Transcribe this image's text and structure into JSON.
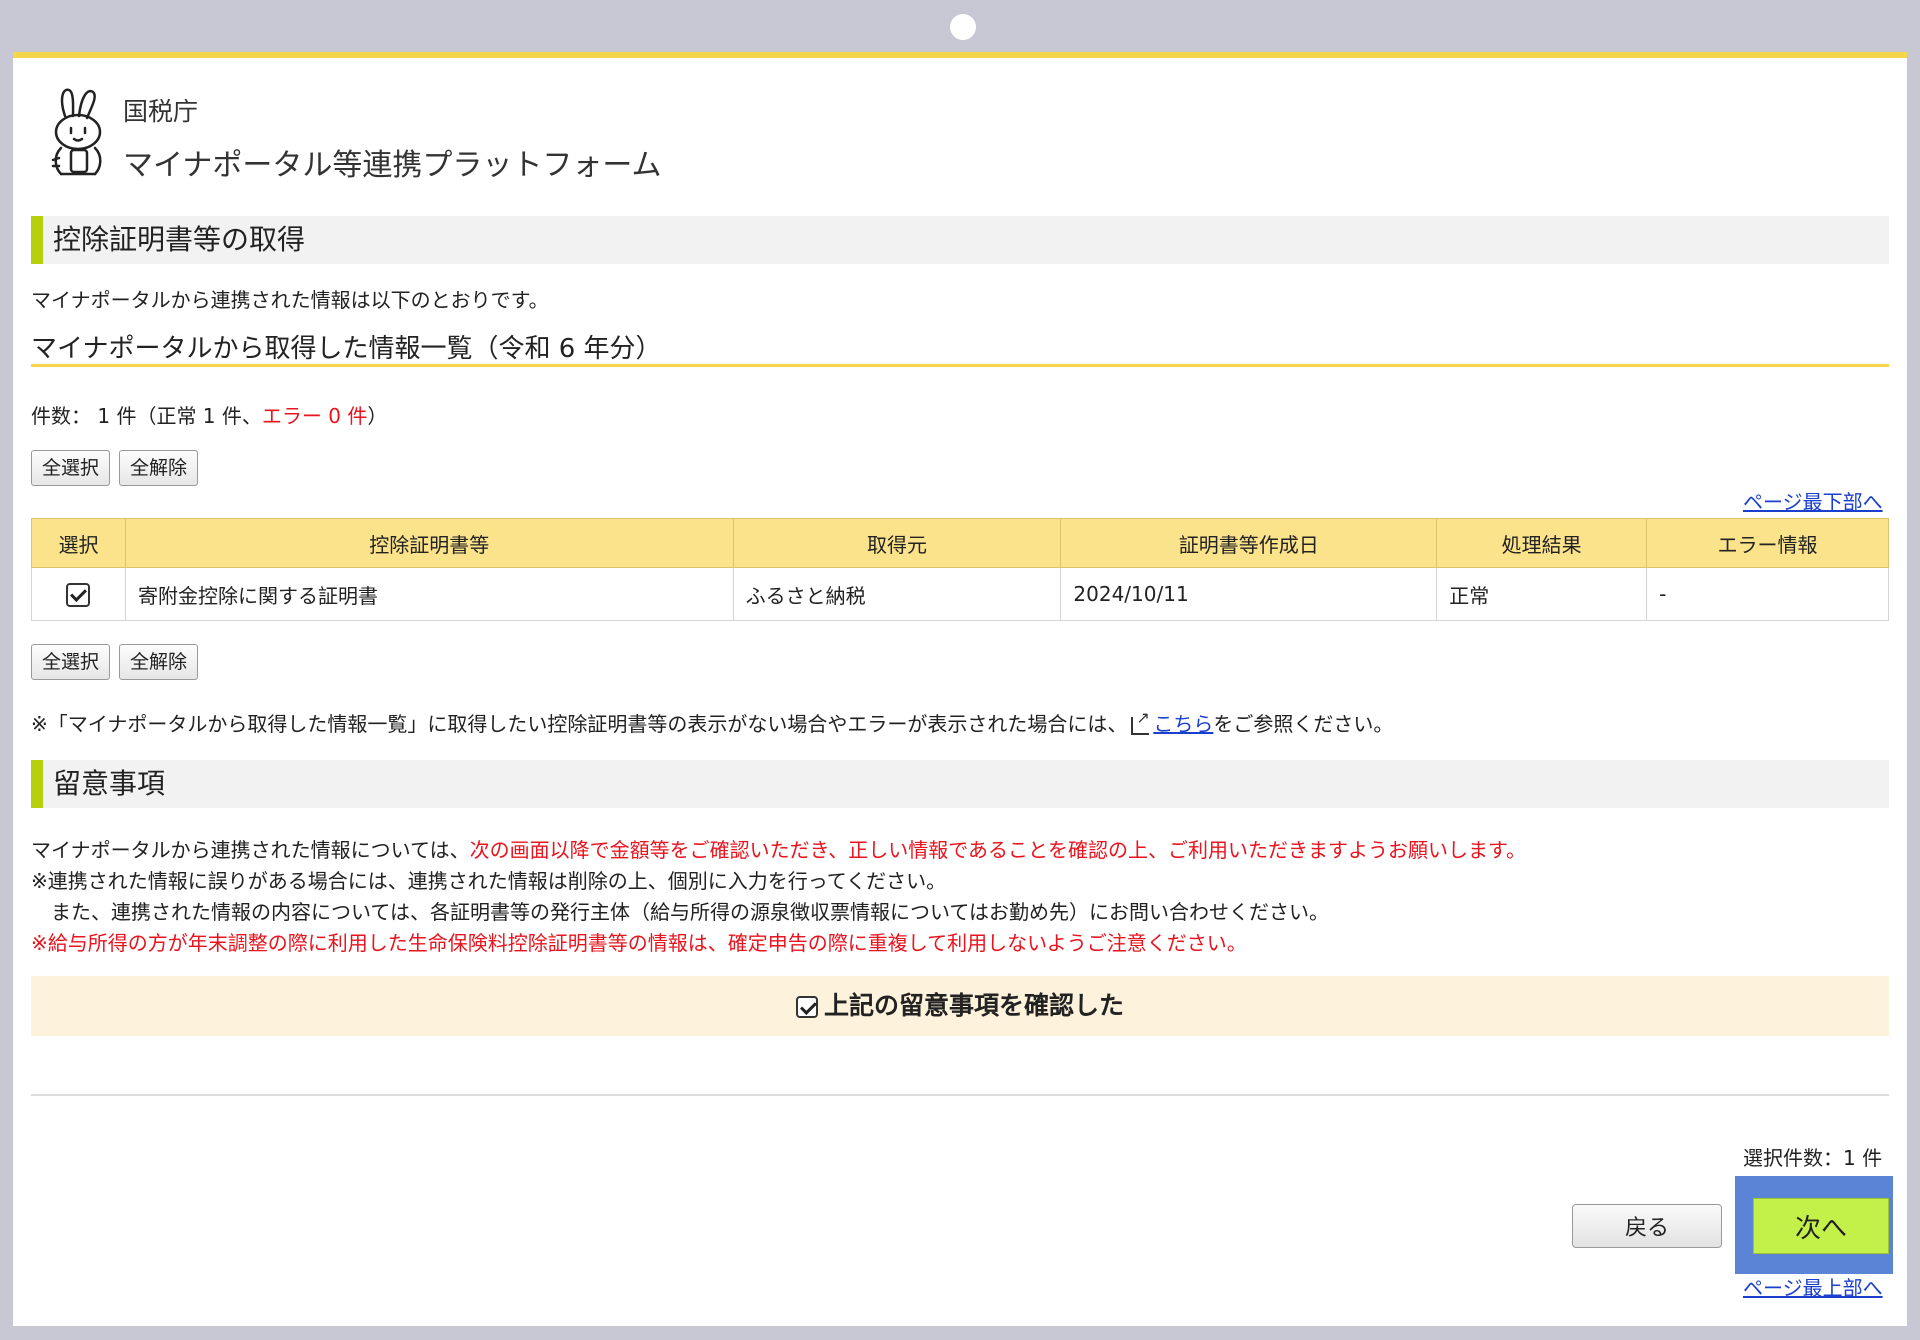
{
  "header": {
    "org": "国税庁",
    "platform": "マイナポータル等連携プラットフォーム"
  },
  "section1": {
    "title": "控除証明書等の取得",
    "intro": "マイナポータルから連携された情報は以下のとおりです。",
    "list_title": "マイナポータルから取得した情報一覧（令和 6 年分）",
    "count_prefix": "件数： 1 件（正常 1 件、",
    "count_error": "エラー 0 件",
    "count_suffix": "）",
    "select_all": "全選択",
    "clear_all": "全解除",
    "to_bottom": "ページ最下部へ"
  },
  "table": {
    "headers": [
      "選択",
      "控除証明書等",
      "取得元",
      "証明書等作成日",
      "処理結果",
      "エラー情報"
    ],
    "rows": [
      {
        "checked": true,
        "certificate": "寄附金控除に関する証明書",
        "source": "ふるさと納税",
        "date": "2024/10/11",
        "result": "正常",
        "error": "-"
      }
    ]
  },
  "note": {
    "prefix": "※「マイナポータルから取得した情報一覧」に取得したい控除証明書等の表示がない場合やエラーが表示された場合には、",
    "link": "こちら",
    "suffix": "をご参照ください。"
  },
  "section2": {
    "title": "留意事項",
    "line1_prefix": "マイナポータルから連携された情報については、",
    "line1_red": "次の画面以降で金額等をご確認いただき、正しい情報であることを確認の上、ご利用いただきますようお願いします。",
    "line2": "※連携された情報に誤りがある場合には、連携された情報は削除の上、個別に入力を行ってください。",
    "line3": "　また、連携された情報の内容については、各証明書等の発行主体（給与所得の源泉徴収票情報についてはお勤め先）にお問い合わせください。",
    "line4": "※給与所得の方が年末調整の際に利用した生命保険料控除証明書等の情報は、確定申告の際に重複して利用しないようご注意ください。",
    "confirm": "上記の留意事項を確認した"
  },
  "footer": {
    "selected_count": "選択件数：1 件",
    "back": "戻る",
    "next": "次へ",
    "to_top": "ページ最上部へ"
  },
  "colors": {
    "accent_bar": "#b6d10b",
    "table_header": "#fbe38b",
    "next_button": "#c4f04a",
    "error_text": "#e8141e"
  }
}
